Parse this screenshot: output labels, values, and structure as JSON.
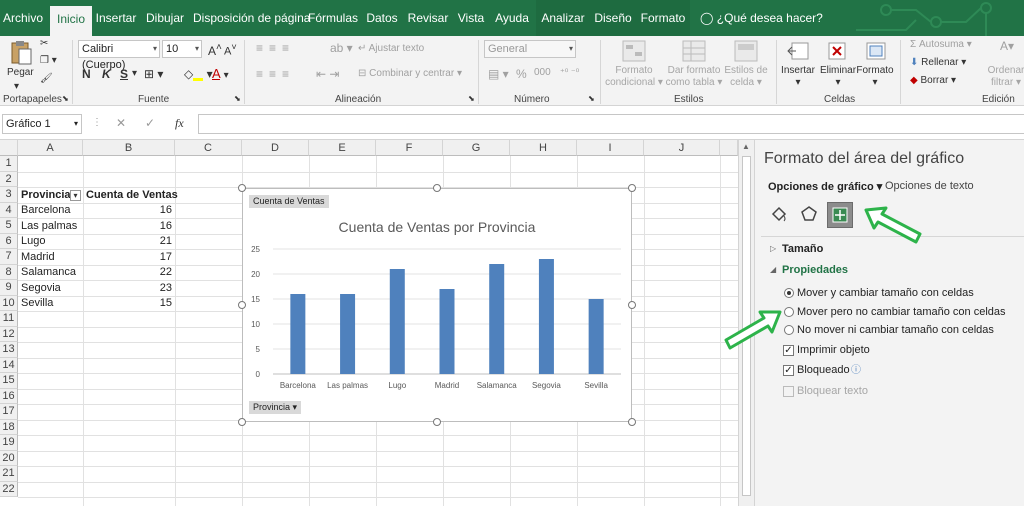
{
  "tabs": [
    "Archivo",
    "Inicio",
    "Insertar",
    "Dibujar",
    "Disposición de página",
    "Fórmulas",
    "Datos",
    "Revisar",
    "Vista",
    "Ayuda",
    "Analizar",
    "Diseño",
    "Formato"
  ],
  "active_tab": "Inicio",
  "tell_me": "¿Qué desea hacer?",
  "ribbon": {
    "portapapeles": {
      "paste": "Pegar",
      "label": "Portapapeles"
    },
    "fuente": {
      "font_name": "Calibri (Cuerpo)",
      "font_size": "10",
      "bold": "N",
      "italic": "K",
      "underline": "S",
      "label": "Fuente"
    },
    "alineacion": {
      "wrap": "Ajustar texto",
      "merge": "Combinar y centrar",
      "label": "Alineación"
    },
    "numero": {
      "format": "General",
      "label": "Número"
    },
    "estilos": {
      "cond": "Formato",
      "cond2": "condicional",
      "table": "Dar formato",
      "table2": "como tabla",
      "cell": "Estilos de",
      "cell2": "celda",
      "label": "Estilos"
    },
    "celdas": {
      "insert": "Insertar",
      "delete": "Eliminar",
      "format": "Formato",
      "label": "Celdas"
    },
    "edicion": {
      "autosum": "Autosuma",
      "fill": "Rellenar",
      "clear": "Borrar",
      "sort": "Ordenar",
      "sort2": "filtrar",
      "label": "Edición"
    }
  },
  "formula_bar": {
    "name_box": "Gráfico 1",
    "fx": "fx",
    "cancel": "✕",
    "enter": "✓"
  },
  "columns": [
    "A",
    "B",
    "C",
    "D",
    "E",
    "F",
    "G",
    "H",
    "I",
    "J"
  ],
  "rows": [
    "1",
    "2",
    "3",
    "4",
    "5",
    "6",
    "7",
    "8",
    "9",
    "10",
    "11",
    "12",
    "13",
    "14",
    "15",
    "16",
    "17",
    "18",
    "19",
    "20",
    "21",
    "22"
  ],
  "table": {
    "headers": [
      "Provincia",
      "Cuenta de Ventas"
    ],
    "rows": [
      [
        "Barcelona",
        "16"
      ],
      [
        "Las palmas",
        "16"
      ],
      [
        "Lugo",
        "21"
      ],
      [
        "Madrid",
        "17"
      ],
      [
        "Salamanca",
        "22"
      ],
      [
        "Segovia",
        "23"
      ],
      [
        "Sevilla",
        "15"
      ]
    ]
  },
  "chart_data": {
    "type": "bar",
    "title": "Cuenta de Ventas por Provincia",
    "categories": [
      "Barcelona",
      "Las palmas",
      "Lugo",
      "Madrid",
      "Salamanca",
      "Segovia",
      "Sevilla"
    ],
    "values": [
      16,
      16,
      21,
      17,
      22,
      23,
      15
    ],
    "ylim": [
      0,
      25
    ],
    "yticks": [
      "0",
      "5",
      "10",
      "15",
      "20",
      "25"
    ],
    "grid": true,
    "bar_color": "#4f81bd",
    "field_value_button": "Cuenta de Ventas",
    "field_axis_button": "Provincia"
  },
  "pane": {
    "title": "Formato del área del gráfico",
    "tab1": "Opciones de gráfico",
    "tab2": "Opciones de texto",
    "section1": "Tamaño",
    "section2": "Propiedades",
    "radio1": "Mover y cambiar tamaño con celdas",
    "radio2": "Mover pero no cambiar tamaño con celdas",
    "radio3": "No mover ni cambiar tamaño con celdas",
    "check1": "Imprimir objeto",
    "check2": "Bloqueado",
    "check3": "Bloquear texto"
  },
  "colors": {
    "excel_green": "#217346",
    "annotation_green": "#2db34a"
  }
}
